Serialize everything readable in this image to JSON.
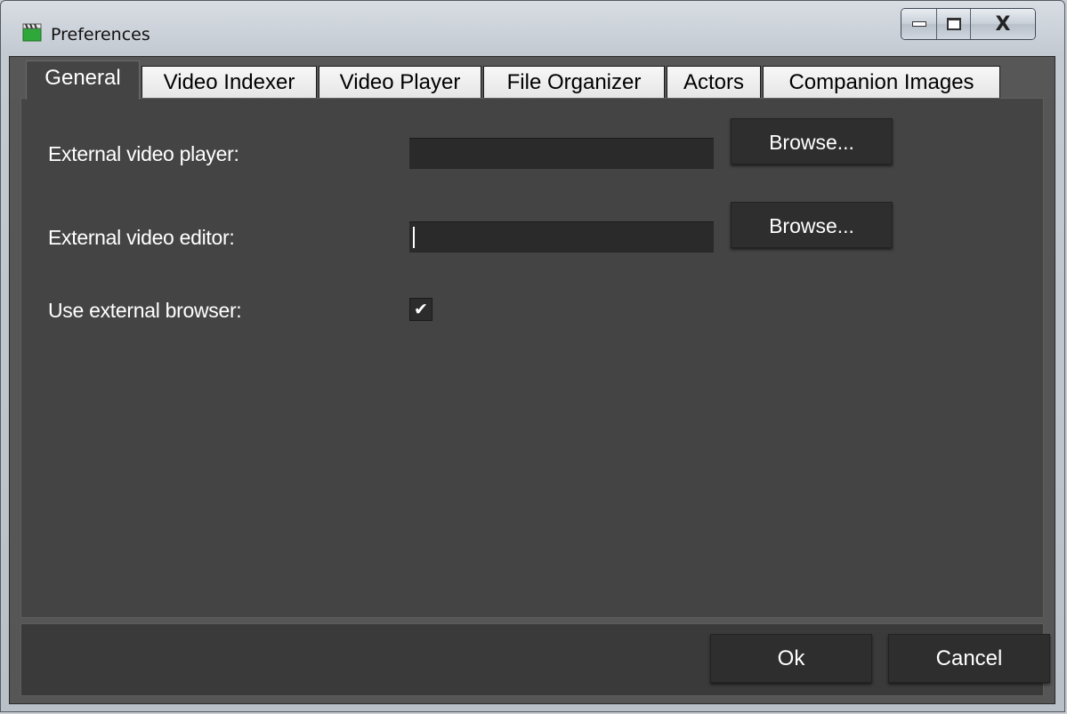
{
  "window": {
    "title": "Preferences",
    "controls": {
      "minimize_icon": "minimize-icon",
      "maximize_icon": "maximize-icon",
      "close_label": "X"
    }
  },
  "tabs": [
    {
      "label": "General",
      "active": true
    },
    {
      "label": "Video Indexer",
      "active": false
    },
    {
      "label": "Video Player",
      "active": false
    },
    {
      "label": "File Organizer",
      "active": false
    },
    {
      "label": "Actors",
      "active": false
    },
    {
      "label": "Companion Images",
      "active": false
    }
  ],
  "general": {
    "player_label": "External video player:",
    "player_value": "",
    "player_browse": "Browse...",
    "editor_label": "External video editor:",
    "editor_value": "",
    "editor_browse": "Browse...",
    "browser_label": "Use external browser:",
    "browser_checked": true,
    "browser_check_glyph": "✔"
  },
  "footer": {
    "ok_label": "Ok",
    "cancel_label": "Cancel"
  },
  "colors": {
    "panel_bg": "#444444",
    "field_bg": "#2a2a2a",
    "button_bg": "#2e2e2e",
    "text": "#ffffff"
  }
}
